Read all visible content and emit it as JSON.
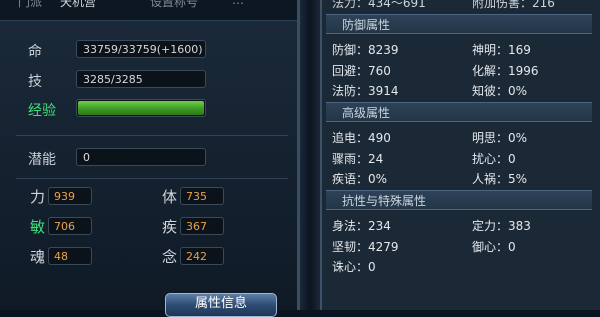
{
  "left": {
    "top_partial": [
      "门派",
      "天机营",
      "设置称号",
      "…"
    ],
    "stats": [
      {
        "label": "命",
        "value": "33759/33759(+1600)"
      },
      {
        "label": "技",
        "value": "3285/3285"
      },
      {
        "label": "经验",
        "value": "",
        "fill": 1.0
      },
      {
        "label": "潜能",
        "value": "0"
      }
    ],
    "attrs": [
      {
        "label": "力",
        "value": "939"
      },
      {
        "label": "体",
        "value": "735"
      },
      {
        "label": "敏",
        "value": "706"
      },
      {
        "label": "疾",
        "value": "367"
      },
      {
        "label": "魂",
        "value": "48"
      },
      {
        "label": "念",
        "value": "242"
      }
    ],
    "button_label": "属性信息"
  },
  "right": {
    "top_partial": {
      "left": "法力：434～691",
      "right": "附加伤害：216"
    },
    "sections": [
      {
        "header": "防御属性",
        "items": [
          {
            "label": "防御：",
            "value": "8239"
          },
          {
            "label": "神明：",
            "value": "169"
          },
          {
            "label": "回避：",
            "value": "760"
          },
          {
            "label": "化解：",
            "value": "1996"
          },
          {
            "label": "法防：",
            "value": "3914"
          },
          {
            "label": "知彼：",
            "value": "0%"
          }
        ]
      },
      {
        "header": "高级属性",
        "items": [
          {
            "label": "追电：",
            "value": "490"
          },
          {
            "label": "明思：",
            "value": "0%"
          },
          {
            "label": "骤雨：",
            "value": "24"
          },
          {
            "label": "扰心：",
            "value": "0"
          },
          {
            "label": "疾语：",
            "value": "0%"
          },
          {
            "label": "人祸：",
            "value": "5%"
          }
        ]
      },
      {
        "header": "抗性与特殊属性",
        "items": [
          {
            "label": "身法：",
            "value": "234"
          },
          {
            "label": "定力：",
            "value": "383"
          },
          {
            "label": "坚韧：",
            "value": "4279"
          },
          {
            "label": "御心：",
            "value": "0"
          },
          {
            "label": "诛心：",
            "value": "0"
          }
        ]
      }
    ]
  },
  "colors": {
    "exp_bar": "#4db52a",
    "attr_value": "#e8a34a",
    "green_label": "#3fe07a"
  }
}
